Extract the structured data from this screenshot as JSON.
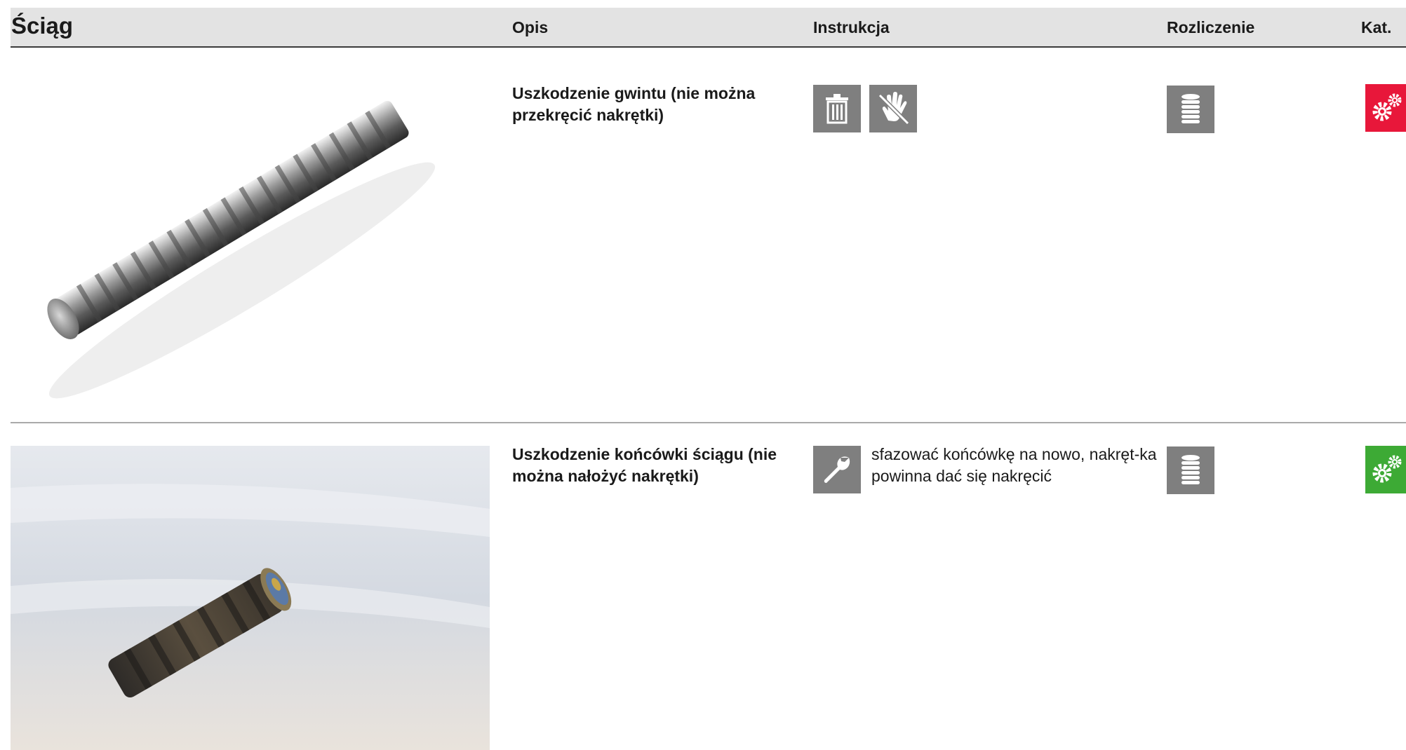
{
  "header": {
    "title": "Ściąg",
    "col_opis": "Opis",
    "col_instrukcja": "Instrukcja",
    "col_rozliczenie": "Rozliczenie",
    "col_kat": "Kat."
  },
  "rows": [
    {
      "description": "Uszkodzenie gwintu (nie można przekręcić nakrętki)",
      "instruction_icons": [
        "trash-icon",
        "no-touch-hand-icon"
      ],
      "instruction_text": "",
      "settlement_icon": "coin-stack-icon",
      "category_icon": "gears-icon",
      "category_color": "#e8173a"
    },
    {
      "description": "Uszkodzenie końcówki ściągu (nie można nałożyć nakrętki)",
      "instruction_icons": [
        "wrench-icon"
      ],
      "instruction_text": "sfazować końcówkę na nowo, nakręt-ka powinna dać się nakręcić",
      "settlement_icon": "coin-stack-icon",
      "category_icon": "gears-icon",
      "category_color": "#3daa35"
    }
  ],
  "colors": {
    "header_bg": "#e3e3e3",
    "icon_tile": "#7f7f7f",
    "divider": "#a9a9a9"
  }
}
